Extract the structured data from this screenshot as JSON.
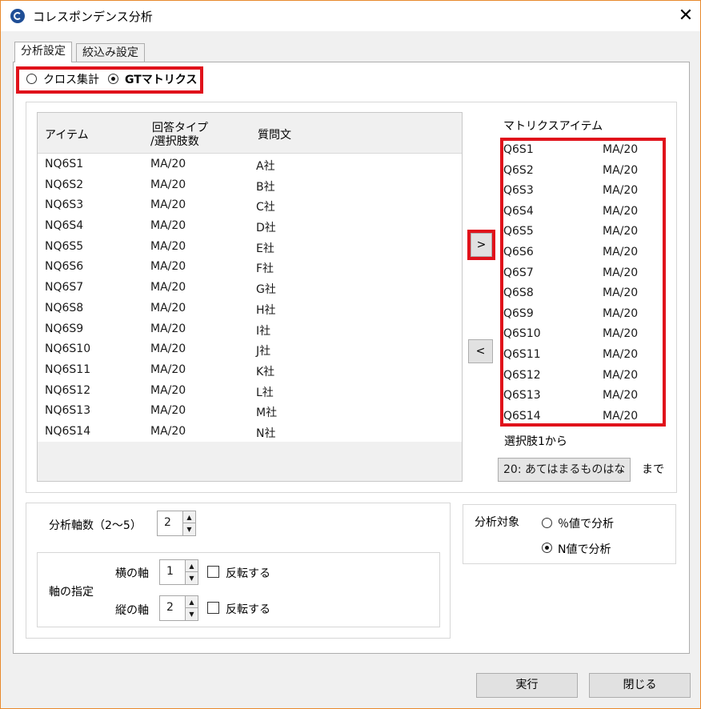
{
  "window": {
    "title": "コレスポンデンス分析",
    "close_glyph": "✕"
  },
  "tabs": [
    {
      "label": "分析設定"
    },
    {
      "label": "絞込み設定"
    }
  ],
  "mode": {
    "option1": "クロス集計",
    "option2": "GTマトリクス",
    "selected": "GTマトリクス"
  },
  "grid": {
    "headers": {
      "item": "アイテム",
      "type_line1": "回答タイプ",
      "type_line2": "/選択肢数",
      "question": "質問文"
    },
    "rows": [
      {
        "item": "NQ6S1",
        "type": "MA/20",
        "question": "A社"
      },
      {
        "item": "NQ6S2",
        "type": "MA/20",
        "question": "B社"
      },
      {
        "item": "NQ6S3",
        "type": "MA/20",
        "question": "C社"
      },
      {
        "item": "NQ6S4",
        "type": "MA/20",
        "question": "D社"
      },
      {
        "item": "NQ6S5",
        "type": "MA/20",
        "question": "E社"
      },
      {
        "item": "NQ6S6",
        "type": "MA/20",
        "question": "F社"
      },
      {
        "item": "NQ6S7",
        "type": "MA/20",
        "question": "G社"
      },
      {
        "item": "NQ6S8",
        "type": "MA/20",
        "question": "H社"
      },
      {
        "item": "NQ6S9",
        "type": "MA/20",
        "question": "I社"
      },
      {
        "item": "NQ6S10",
        "type": "MA/20",
        "question": "J社"
      },
      {
        "item": "NQ6S11",
        "type": "MA/20",
        "question": "K社"
      },
      {
        "item": "NQ6S12",
        "type": "MA/20",
        "question": "L社"
      },
      {
        "item": "NQ6S13",
        "type": "MA/20",
        "question": "M社"
      },
      {
        "item": "NQ6S14",
        "type": "MA/20",
        "question": "N社"
      }
    ]
  },
  "transfer": {
    "add": ">",
    "remove": "<"
  },
  "matrix": {
    "label": "マトリクスアイテム",
    "rows": [
      {
        "item": "Q6S1",
        "type": "MA/20"
      },
      {
        "item": "Q6S2",
        "type": "MA/20"
      },
      {
        "item": "Q6S3",
        "type": "MA/20"
      },
      {
        "item": "Q6S4",
        "type": "MA/20"
      },
      {
        "item": "Q6S5",
        "type": "MA/20"
      },
      {
        "item": "Q6S6",
        "type": "MA/20"
      },
      {
        "item": "Q6S7",
        "type": "MA/20"
      },
      {
        "item": "Q6S8",
        "type": "MA/20"
      },
      {
        "item": "Q6S9",
        "type": "MA/20"
      },
      {
        "item": "Q6S10",
        "type": "MA/20"
      },
      {
        "item": "Q6S11",
        "type": "MA/20"
      },
      {
        "item": "Q6S12",
        "type": "MA/20"
      },
      {
        "item": "Q6S13",
        "type": "MA/20"
      },
      {
        "item": "Q6S14",
        "type": "MA/20"
      }
    ],
    "range_from_label": "選択肢1から",
    "range_to_value": "20: あてはまるものはな",
    "range_to_suffix": "まで"
  },
  "axes": {
    "count_label": "分析軸数（2〜5）",
    "count_value": "2",
    "spec_label": "軸の指定",
    "horizontal": {
      "label": "横の軸",
      "value": "1",
      "invert_label": "反転する",
      "invert_checked": false
    },
    "vertical": {
      "label": "縦の軸",
      "value": "2",
      "invert_label": "反転する",
      "invert_checked": false
    }
  },
  "target": {
    "label": "分析対象",
    "option1": "％値で分析",
    "option2": "N値で分析",
    "selected": "N値で分析"
  },
  "footer": {
    "run": "実行",
    "close": "閉じる"
  }
}
